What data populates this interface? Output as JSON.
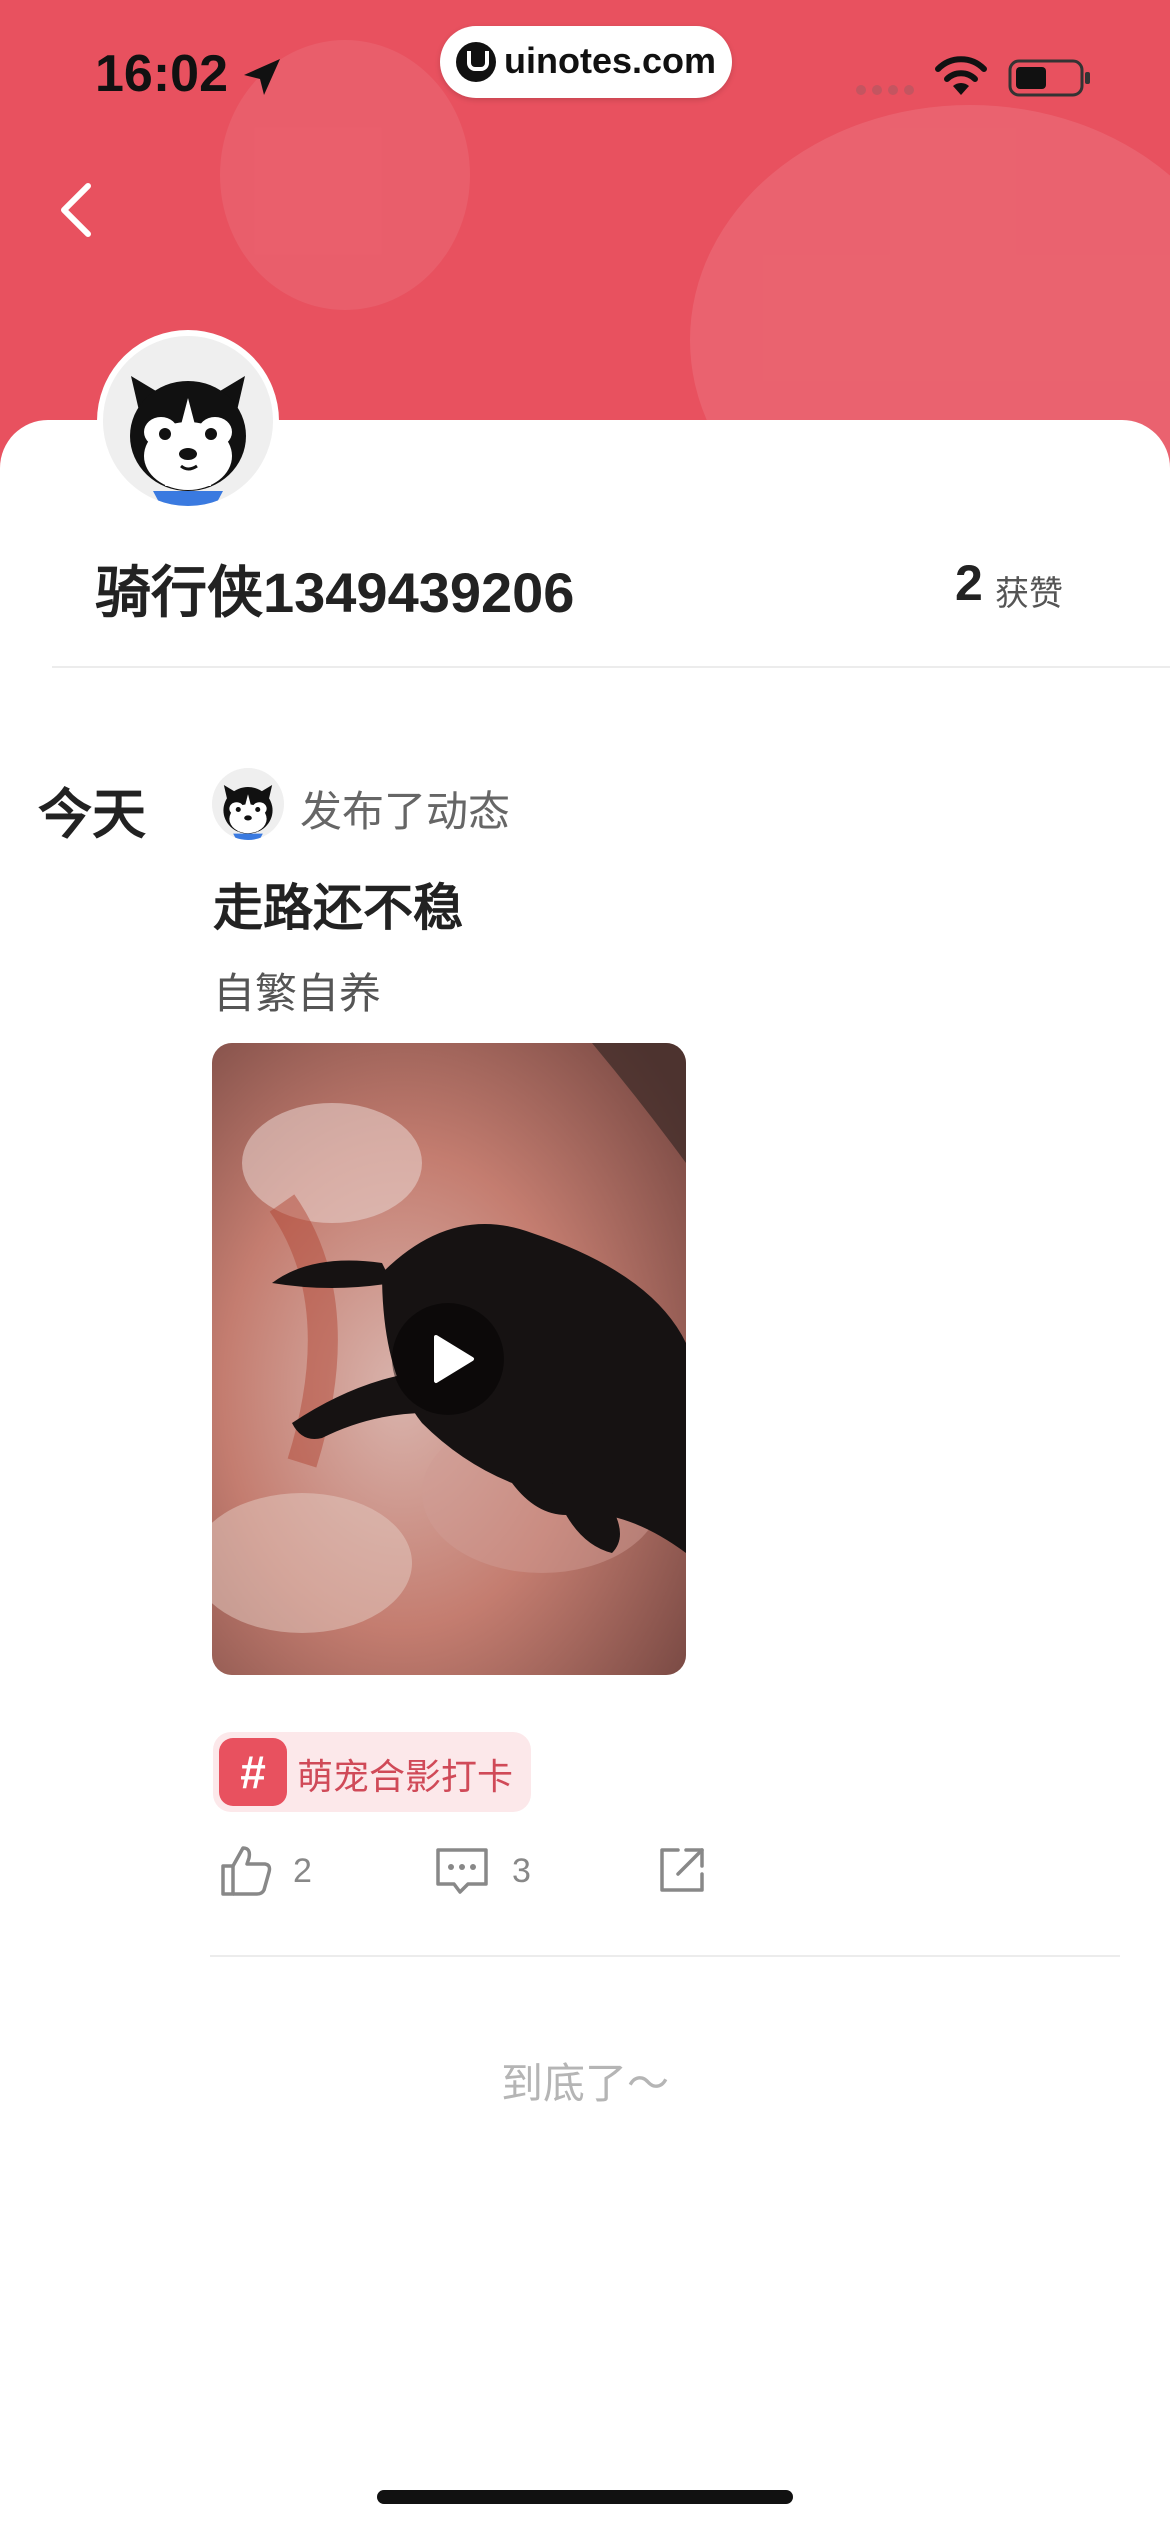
{
  "status_bar": {
    "time": "16:02",
    "url": "uinotes.com"
  },
  "profile": {
    "username": "骑行侠1349439206",
    "likes_count": "2",
    "likes_label": "获赞"
  },
  "post": {
    "date": "今天",
    "action": "发布了动态",
    "title": "走路还不稳",
    "subtitle": "自繁自养",
    "topic_hash": "#",
    "topic": "萌宠合影打卡",
    "like_count": "2",
    "comment_count": "3"
  },
  "footer": {
    "end_text": "到底了～"
  },
  "colors": {
    "header": "#e8515f",
    "tag_bg": "#fce8ea",
    "tag_text": "#d04a58"
  },
  "icons": {
    "back": "chevron-left-icon",
    "like": "thumbs-up-icon",
    "comment": "comment-icon",
    "share": "share-icon",
    "play": "play-icon"
  }
}
